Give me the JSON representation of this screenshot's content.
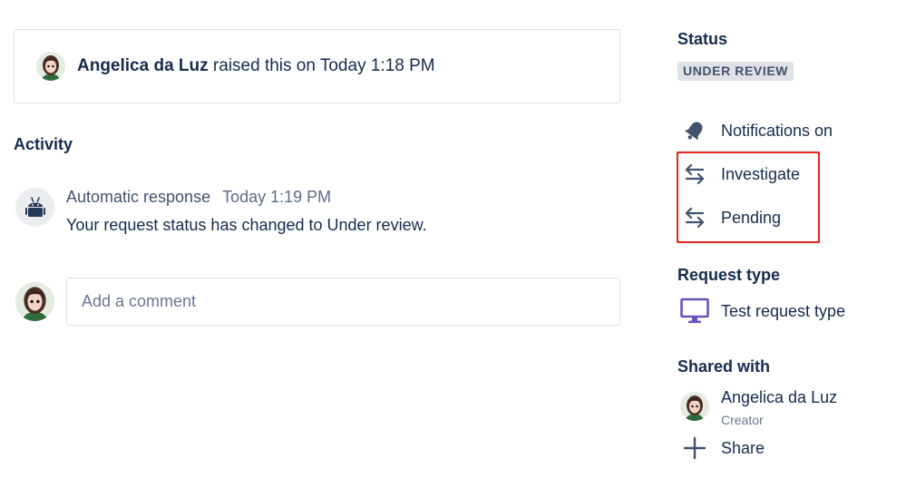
{
  "raised": {
    "name": "Angelica da Luz",
    "text": "raised this on Today 1:18 PM"
  },
  "activity": {
    "heading": "Activity",
    "items": [
      {
        "author": "Automatic response",
        "time": "Today 1:19 PM",
        "text": "Your request status has changed to Under review."
      }
    ]
  },
  "comment": {
    "placeholder": "Add a comment"
  },
  "sidebar": {
    "status_heading": "Status",
    "status_value": "UNDER REVIEW",
    "actions": [
      {
        "label": "Notifications on",
        "icon": "bell-icon"
      },
      {
        "label": "Investigate",
        "icon": "transition-arrows-icon"
      },
      {
        "label": "Pending",
        "icon": "transition-arrows-icon"
      }
    ],
    "request_type_heading": "Request type",
    "request_type": {
      "label": "Test request type",
      "icon": "monitor-icon"
    },
    "shared_heading": "Shared with",
    "shared_person": {
      "name": "Angelica da Luz",
      "role": "Creator"
    },
    "share_label": "Share"
  },
  "colors": {
    "text": "#172b4d",
    "muted": "#6b778c",
    "lozenge_bg": "#dfe1e6",
    "highlight": "#e2261b",
    "request_type_icon": "#6554c0"
  }
}
